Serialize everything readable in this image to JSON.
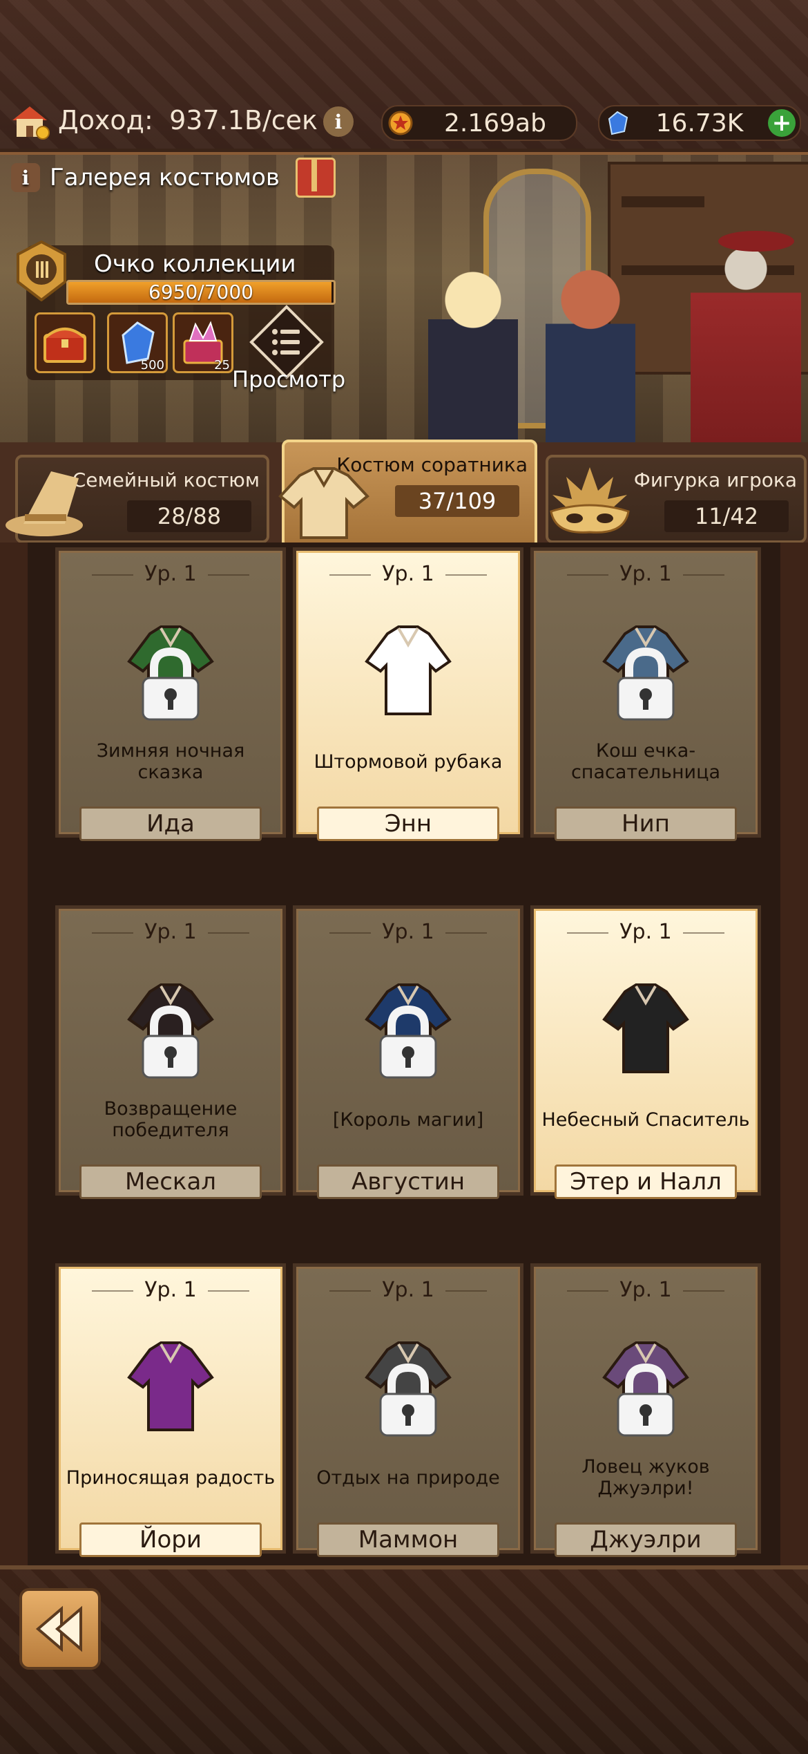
{
  "header": {
    "income_label": "Доход:",
    "income_value": "937.1B/сек",
    "coins": "2.169ab",
    "gems": "16.73K"
  },
  "banner": {
    "gallery_title": "Галерея костюмов",
    "collection_title": "Очко коллекции",
    "collection_progress": "6950/7000",
    "collection_fraction": 0.993,
    "rewards": [
      {
        "icon": "chest-icon",
        "count": ""
      },
      {
        "icon": "blue-gem-icon",
        "count": "500"
      },
      {
        "icon": "crystal-chest-icon",
        "count": "25"
      }
    ],
    "view_label": "Просмотр"
  },
  "tabs": [
    {
      "name": "Семейный костюм",
      "count": "28/88",
      "icon": "witch-hat-icon"
    },
    {
      "name": "Костюм соратника",
      "count": "37/109",
      "icon": "shirt-icon",
      "active": true
    },
    {
      "name": "Фигурка игрока",
      "count": "11/42",
      "icon": "mask-icon"
    }
  ],
  "cards": [
    {
      "level": "Ур. 1",
      "name": "Зимняя ночная сказка",
      "owner": "Ида",
      "locked": true,
      "color": "#2f6a2e"
    },
    {
      "level": "Ур. 1",
      "name": "Штормовой рубака",
      "owner": "Энн",
      "locked": false,
      "color": "#ffffff"
    },
    {
      "level": "Ур. 1",
      "name": "Кош ечка-спасательница",
      "owner": "Нип",
      "locked": true,
      "color": "#4a6a8a"
    },
    {
      "level": "Ур. 1",
      "name": "Возвращение победителя",
      "owner": "Мескал",
      "locked": true,
      "color": "#2a2020"
    },
    {
      "level": "Ур. 1",
      "name": "[Король магии]",
      "owner": "Августин",
      "locked": true,
      "color": "#1e3a6a"
    },
    {
      "level": "Ур. 1",
      "name": "Небесный Спаситель",
      "owner": "Этер и Налл",
      "locked": false,
      "color": "#222222"
    },
    {
      "level": "Ур. 1",
      "name": "Приносящая радость",
      "owner": "Йори",
      "locked": false,
      "color": "#7a2a8a"
    },
    {
      "level": "Ур. 1",
      "name": "Отдых на природе",
      "owner": "Маммон",
      "locked": true,
      "color": "#444444"
    },
    {
      "level": "Ур. 1",
      "name": "Ловец жуков Джуэлри!",
      "owner": "Джуэлри",
      "locked": true,
      "color": "#6a4a7a"
    }
  ]
}
